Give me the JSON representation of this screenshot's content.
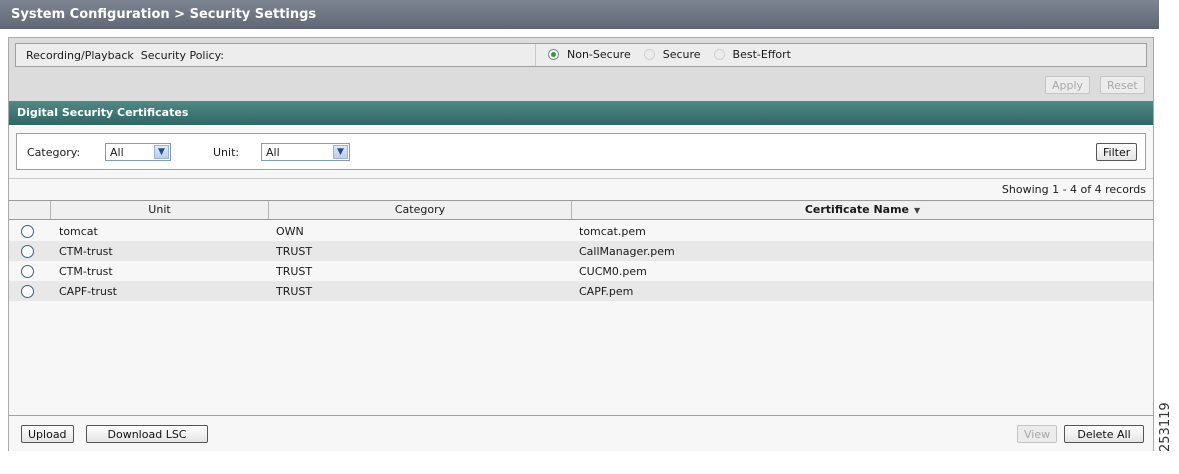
{
  "title": "System Configuration > Security Settings",
  "policy": {
    "label": "Recording/Playback  Security Policy:",
    "options": [
      {
        "label": "Non-Secure",
        "checked": true
      },
      {
        "label": "Secure",
        "checked": false
      },
      {
        "label": "Best-Effort",
        "checked": false
      }
    ],
    "apply_label": "Apply",
    "reset_label": "Reset"
  },
  "certificates": {
    "header": "Digital Security Certificates",
    "filter": {
      "category_label": "Category:",
      "category_value": "All",
      "unit_label": "Unit:",
      "unit_value": "All",
      "filter_button": "Filter"
    },
    "records_text": "Showing 1 - 4 of 4 records",
    "columns": [
      "Unit",
      "Category",
      "Certificate Name"
    ],
    "sort_icon": "sort-desc-icon",
    "rows": [
      {
        "unit": "tomcat",
        "category": "OWN",
        "certificate": "tomcat.pem"
      },
      {
        "unit": "CTM-trust",
        "category": "TRUST",
        "certificate": "CallManager.pem"
      },
      {
        "unit": "CTM-trust",
        "category": "TRUST",
        "certificate": "CUCM0.pem"
      },
      {
        "unit": "CAPF-trust",
        "category": "TRUST",
        "certificate": "CAPF.pem"
      }
    ],
    "footer": {
      "upload": "Upload",
      "download_lsc": "Download LSC",
      "view": "View",
      "delete_all": "Delete All"
    }
  },
  "watermark": "253119"
}
